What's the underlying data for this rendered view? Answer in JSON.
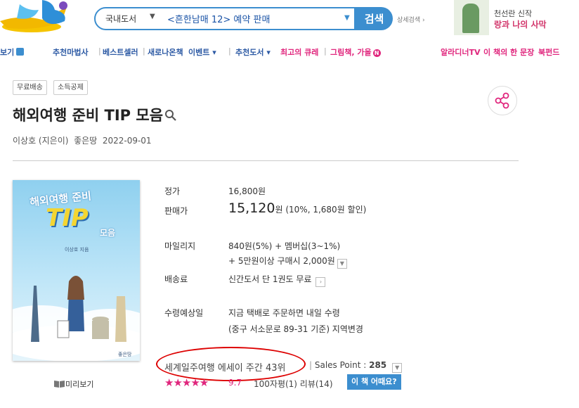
{
  "header": {
    "search_category": "국내도서",
    "search_value": "<흔한남매 12> 예약 판매",
    "search_button": "검색",
    "detail_search": "상세검색 ›",
    "ad_line1": "천선란 신작",
    "ad_line2": "랑과 나의 사막"
  },
  "nav": {
    "items": [
      "보기",
      "추천마법사",
      "베스트셀러",
      "새로나온책",
      "이벤트",
      "추천도서",
      "최고의 큐레",
      "그림책, 가을",
      "알라디너TV",
      "이 책의 한 문장",
      "북펀드"
    ],
    "new_badge": "N"
  },
  "product": {
    "tags": [
      "무료배송",
      "소득공제"
    ],
    "title": "해외여행 준비 TIP 모음",
    "author": "이상호 (지은이)",
    "publisher": "좋은땅",
    "date": "2022-09-01",
    "cover": {
      "title_line1": "해외여행 준비",
      "title_tip": "TIP",
      "title_tail": "모음",
      "author": "이상호 지음",
      "publisher": "좋은땅"
    },
    "preview_label": "미리보기",
    "info": {
      "list_price_label": "정가",
      "list_price": "16,800원",
      "sale_price_label": "판매가",
      "sale_price": "15,120",
      "sale_unit": "원",
      "discount": "(10%, 1,680원 할인)",
      "mileage_label": "마일리지",
      "mileage_line1": "840원(5%) + 멤버십(3~1%)",
      "mileage_line2": "+ 5만원이상 구매시 2,000원",
      "shipping_label": "배송료",
      "shipping": "신간도서 단 1권도 무료",
      "delivery_label": "수령예상일",
      "delivery_line1": "지금 택배로 주문하면 내일 수령",
      "delivery_line2": "(중구 서소문로 89-31 기준) 지역변경"
    },
    "rank": "세계일주여행 에세이 주간 43위",
    "sales_point_label": "Sales Point : ",
    "sales_point": "285",
    "rating": "9.7",
    "reviews": "100자평(1)  리뷰(14)",
    "this_book_button": "이 책 어때요?"
  },
  "colors": {
    "accent": "#3c8ecf",
    "pink": "#e0267d",
    "navy": "#2d5aa4"
  }
}
